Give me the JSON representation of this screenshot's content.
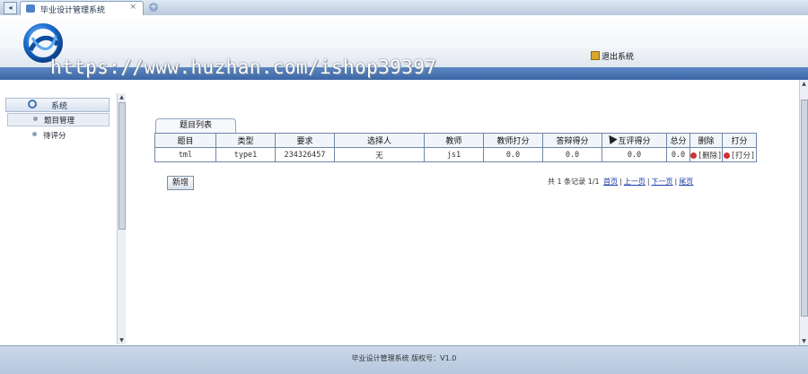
{
  "browser": {
    "tab_title": "毕业设计管理系统",
    "tab_close": "×",
    "tab_add": "+",
    "nav_back": "◂"
  },
  "header": {
    "logout_label": "退出系统"
  },
  "watermark": {
    "text": "https://www.huzhan.com/ishop39397"
  },
  "sidebar": {
    "section_label": "系统",
    "items": [
      {
        "label": "题目管理"
      },
      {
        "label": "待评分"
      }
    ]
  },
  "main": {
    "tab_label": "题目列表",
    "columns": [
      "题目",
      "类型",
      "要求",
      "选择人",
      "教师",
      "教师打分",
      "答辩得分",
      "互评得分",
      "总分",
      "删除",
      "打分"
    ],
    "rows": [
      {
        "title": "tml",
        "type": "type1",
        "requirement": "234326457",
        "chooser": "无",
        "teacher": "js1",
        "teacher_score": "0.0",
        "defense_score": "0.0",
        "peer_score": "0.0",
        "total": "0.0",
        "delete_label": "[删除]",
        "grade_label": "[打分]"
      }
    ],
    "add_button": "新增",
    "pager": {
      "summary": "共 1 条记录 1/1",
      "first": "首页",
      "prev": "上一页",
      "next": "下一页",
      "last": "尾页",
      "sep": "|"
    }
  },
  "footer": {
    "text": "毕业设计管理系统  版权号：V1.0"
  },
  "colors": {
    "accent_bar": "#3d67a6",
    "link": "#1b3ea8",
    "table_border": "#6f86a6"
  }
}
